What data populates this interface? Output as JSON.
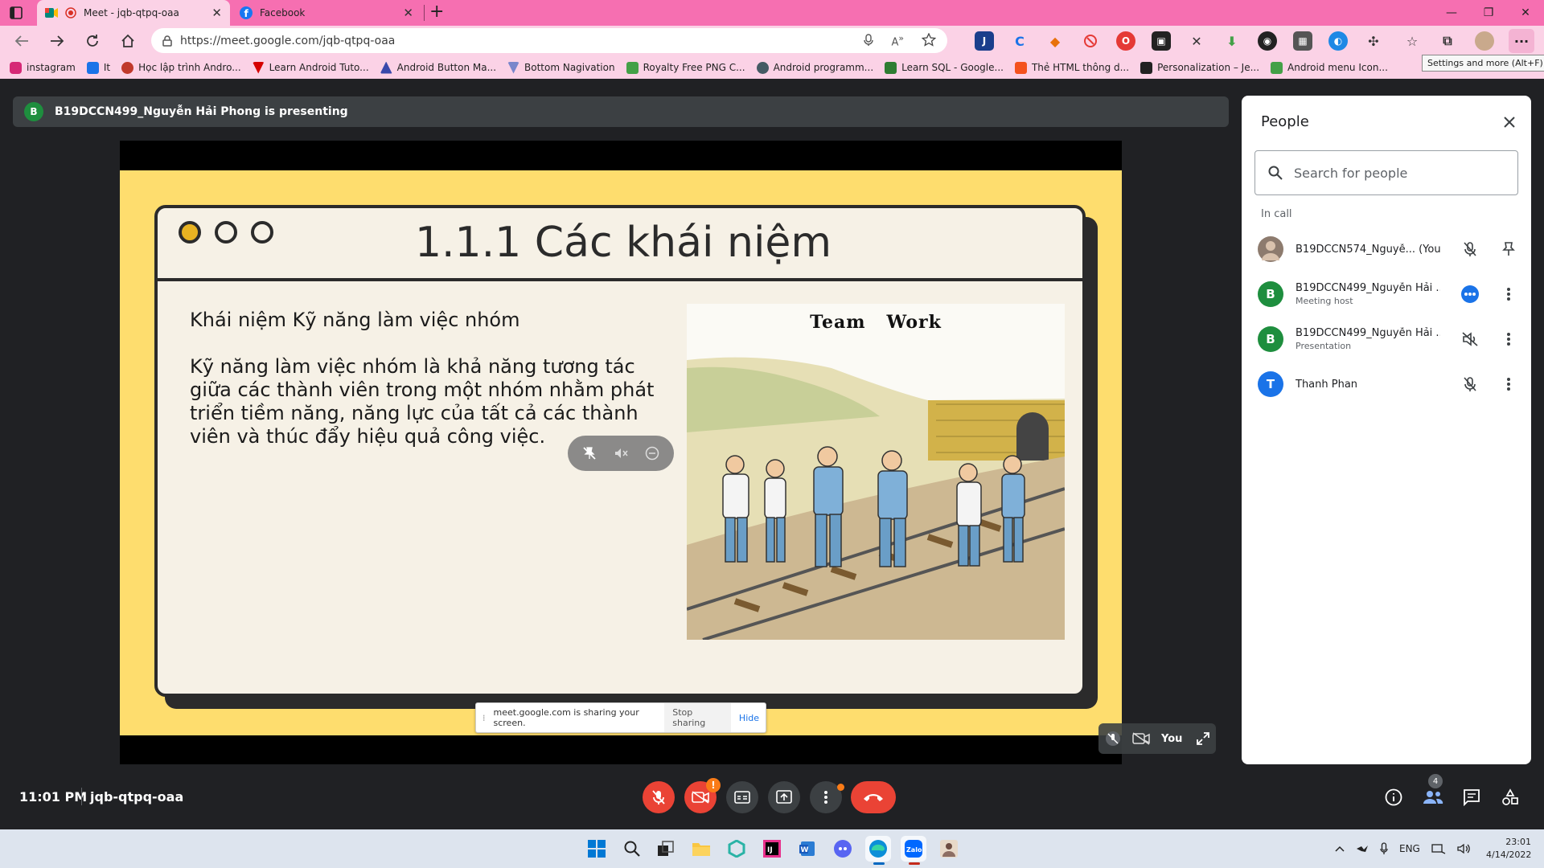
{
  "browser": {
    "tabs": [
      {
        "title": "Meet - jqb-qtpq-oaa",
        "active": true
      },
      {
        "title": "Facebook",
        "active": false
      }
    ],
    "url": "https://meet.google.com/jqb-qtpq-oaa",
    "bookmarks": [
      {
        "label": "instagram",
        "color": "#d62976"
      },
      {
        "label": "It",
        "color": "#1a73e8"
      },
      {
        "label": "Học lập trình Andro...",
        "color": "#c0392b"
      },
      {
        "label": "Learn Android Tuto...",
        "color": "#d50000"
      },
      {
        "label": "Android Button Ma...",
        "color": "#3949ab"
      },
      {
        "label": "Bottom Nagivation",
        "color": "#7986cb"
      },
      {
        "label": "Royalty Free PNG C...",
        "color": "#43a047"
      },
      {
        "label": "Android programm...",
        "color": "#455a64"
      },
      {
        "label": "Learn SQL - Google...",
        "color": "#2e7d32"
      },
      {
        "label": "Thẻ HTML thông d...",
        "color": "#f4511e"
      },
      {
        "label": "Personalization – Je...",
        "color": "#222222"
      },
      {
        "label": "Android menu Icon...",
        "color": "#43a047"
      }
    ],
    "tooltip": "Settings and more (Alt+F)"
  },
  "meet": {
    "presenter_initial": "B",
    "presenting_text": "B19DCCN499_Nguyễn Hải Phong is presenting",
    "slide": {
      "title": "1.1.1 Các khái niệm",
      "subtitle": "Khái niệm Kỹ năng làm việc nhóm",
      "body": "Kỹ năng làm việc nhóm là khả năng tương tác giữa các thành viên trong một nhóm nhằm phát triển tiềm năng, năng lực của tất cả các thành viên và thúc đẩy hiệu quả công việc.",
      "image_caption": "Team   Work"
    },
    "sharing_bar": {
      "text": "meet.google.com is sharing your screen.",
      "stop": "Stop sharing",
      "hide": "Hide"
    },
    "self_tile_label": "You",
    "time": "11:01 PM",
    "meeting_code": "jqb-qtpq-oaa",
    "participants_badge": "4"
  },
  "people_panel": {
    "title": "People",
    "search_placeholder": "Search for people",
    "section": "In call",
    "participants": [
      {
        "name": "B19DCCN574_Nguyễ... (You)",
        "role": "",
        "initial": "",
        "color": "#8d7b6e"
      },
      {
        "name": "B19DCCN499_Nguyễn Hải ...",
        "role": "Meeting host",
        "initial": "B",
        "color": "#1e8e3e"
      },
      {
        "name": "B19DCCN499_Nguyễn Hải ...",
        "role": "Presentation",
        "initial": "B",
        "color": "#1e8e3e"
      },
      {
        "name": "Thanh Phan",
        "role": "",
        "initial": "T",
        "color": "#1a73e8"
      }
    ]
  },
  "taskbar": {
    "language": "ENG",
    "time": "23:01",
    "date": "4/14/2022"
  }
}
